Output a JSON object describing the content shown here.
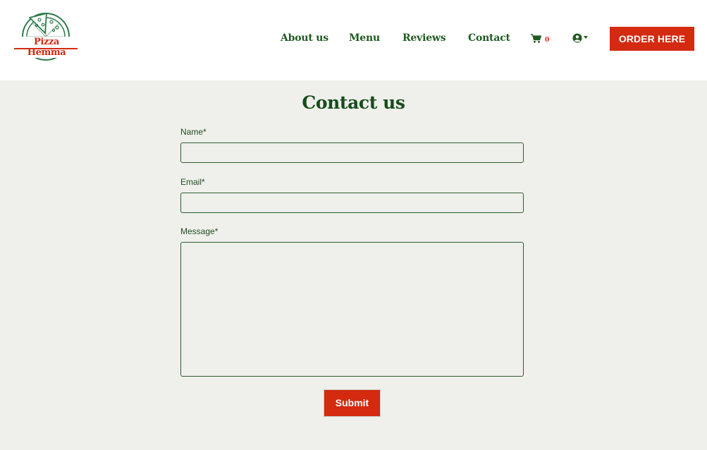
{
  "brand": {
    "name": "Pizza Hemma",
    "accent_color": "#d42a10",
    "primary_color": "#1f5a22",
    "page_bg": "#efefec"
  },
  "nav": {
    "links": [
      {
        "label": "About us"
      },
      {
        "label": "Menu"
      },
      {
        "label": "Reviews"
      },
      {
        "label": "Contact"
      }
    ],
    "cart": {
      "icon": "shopping-cart-icon",
      "count": "0"
    },
    "account": {
      "icon": "user-circle-icon",
      "menu": "chevron-down-icon"
    },
    "order_button": "ORDER HERE"
  },
  "form": {
    "title": "Contact us",
    "fields": {
      "name": {
        "label": "Name*",
        "value": "",
        "placeholder": ""
      },
      "email": {
        "label": "Email*",
        "value": "",
        "placeholder": ""
      },
      "message": {
        "label": "Message*",
        "value": "",
        "placeholder": ""
      }
    },
    "submit_label": "Submit"
  }
}
